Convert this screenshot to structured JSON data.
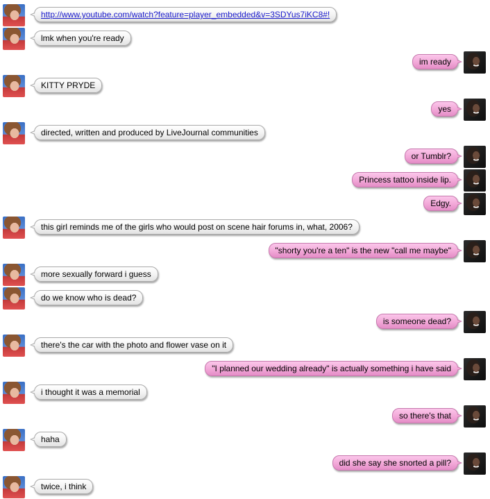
{
  "conversation": {
    "participants": {
      "left": {
        "avatar_icon": "user-avatar-left"
      },
      "right": {
        "avatar_icon": "user-avatar-right"
      }
    },
    "colors": {
      "incoming_bubble": "#f3f3f3",
      "outgoing_bubble": "#f2a8d8",
      "link": "#1a1acc"
    },
    "messages": [
      {
        "side": "left",
        "text": "http://www.youtube.com/watch?feature=player_embedded&v=3SDYus7iKC8#!",
        "is_link": true
      },
      {
        "side": "left",
        "text": "lmk when you're ready"
      },
      {
        "side": "right",
        "text": "im ready"
      },
      {
        "side": "left",
        "text": "KITTY PRYDE"
      },
      {
        "side": "right",
        "text": "yes"
      },
      {
        "side": "left",
        "text": "directed, written and produced by LiveJournal communities"
      },
      {
        "side": "right",
        "text": "or Tumblr?"
      },
      {
        "side": "right",
        "text": "Princess tattoo inside lip."
      },
      {
        "side": "right",
        "text": "Edgy."
      },
      {
        "side": "left",
        "text": "this girl reminds me of the girls who would post on scene hair forums in, what, 2006?"
      },
      {
        "side": "right",
        "text": "\"shorty you're a ten\" is the new \"call me maybe\""
      },
      {
        "side": "left",
        "text": "more sexually forward i guess"
      },
      {
        "side": "left",
        "text": "do we know who is dead?"
      },
      {
        "side": "right",
        "text": "is someone dead?"
      },
      {
        "side": "left",
        "text": "there's the car with the photo and flower vase on it"
      },
      {
        "side": "right",
        "text": "\"I planned our wedding already\" is actually something i have said"
      },
      {
        "side": "left",
        "text": "i thought it was a memorial"
      },
      {
        "side": "right",
        "text": "so there's that"
      },
      {
        "side": "left",
        "text": "haha"
      },
      {
        "side": "right",
        "text": "did she say she snorted a pill?"
      },
      {
        "side": "left",
        "text": "twice, i think"
      }
    ]
  }
}
